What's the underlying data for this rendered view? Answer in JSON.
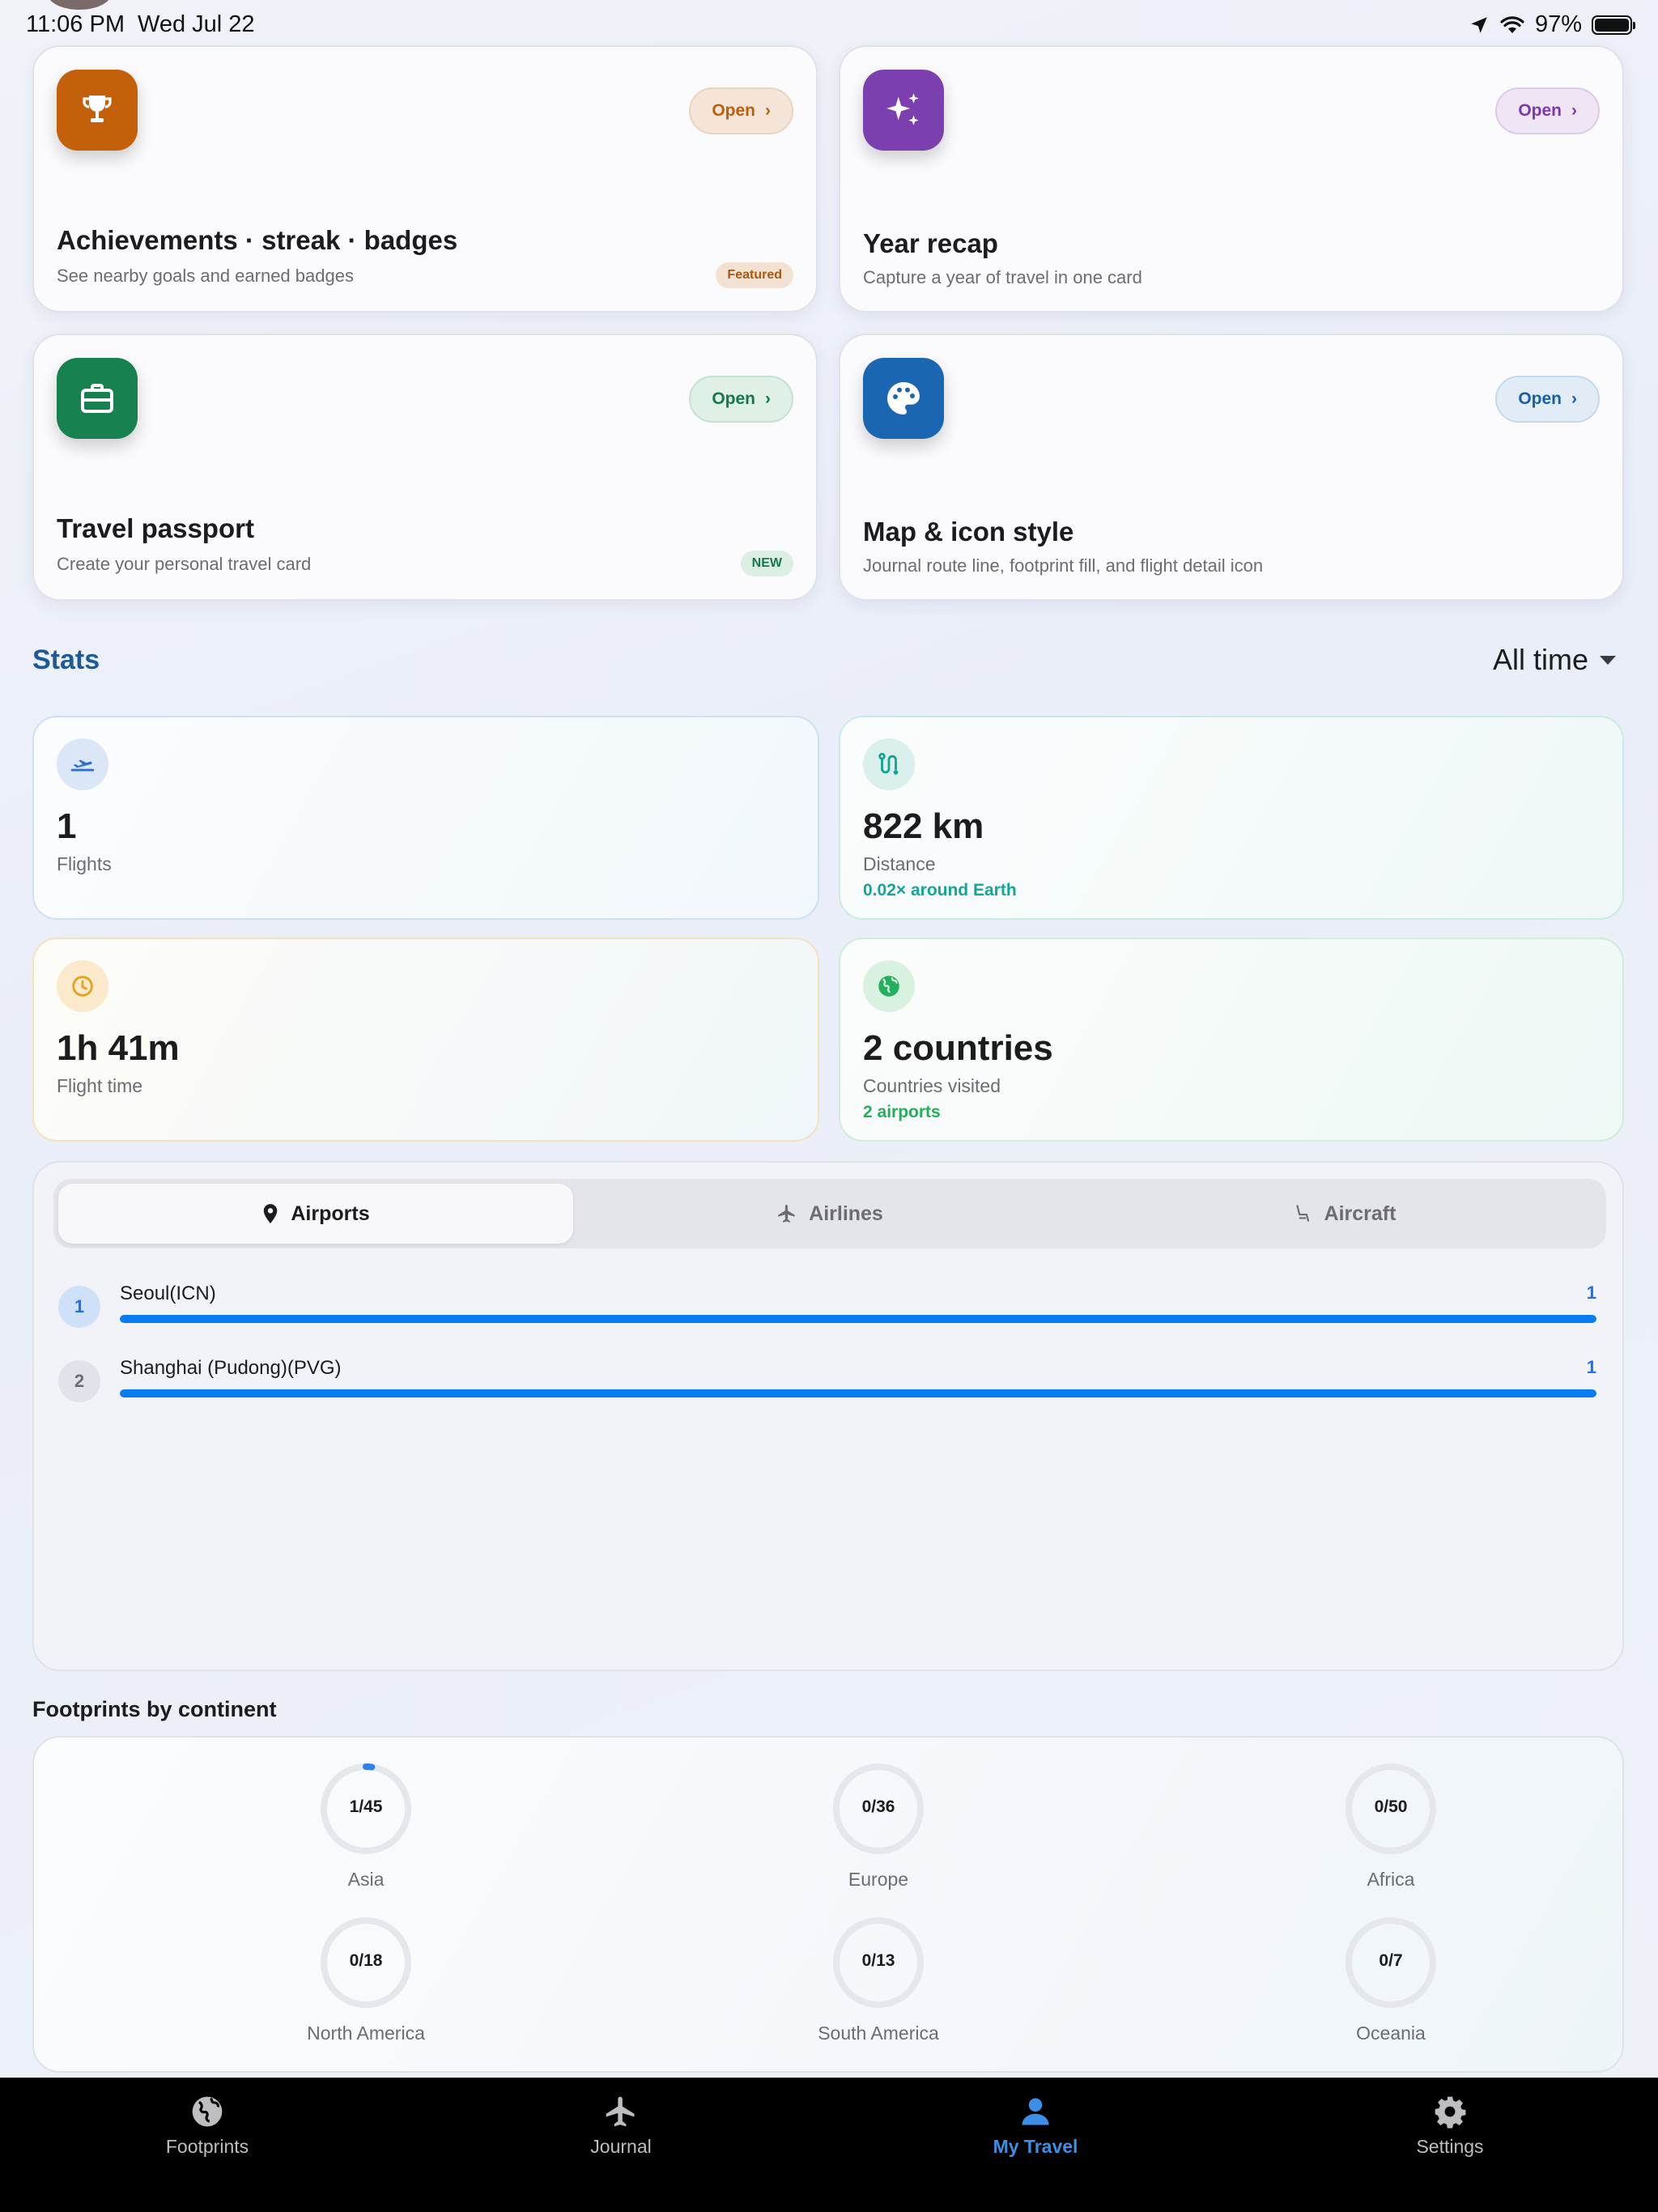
{
  "status_bar": {
    "time": "11:06 PM",
    "date": "Wed Jul 22",
    "battery": "97%"
  },
  "feature_cards": [
    {
      "title": "Achievements · streak · badges",
      "subtitle": "See nearby goals and earned badges",
      "open": "Open",
      "tag": "Featured",
      "icon": "trophy-icon",
      "color": "#c4600a"
    },
    {
      "title": "Year recap",
      "subtitle": "Capture a year of travel in one card",
      "open": "Open",
      "icon": "sparkles-icon",
      "color": "#7b3fb0"
    },
    {
      "title": "Travel passport",
      "subtitle": "Create your personal travel card",
      "open": "Open",
      "tag": "NEW",
      "icon": "briefcase-icon",
      "color": "#17814f"
    },
    {
      "title": "Map & icon style",
      "subtitle": "Journal route line, footprint fill, and flight detail icon",
      "open": "Open",
      "icon": "palette-icon",
      "color": "#1a66b0"
    }
  ],
  "stats": {
    "title": "Stats",
    "range": "All time",
    "tiles": [
      {
        "value": "1",
        "label": "Flights",
        "icon": "plane-departure-icon"
      },
      {
        "value": "822 km",
        "label": "Distance",
        "extra": "0.02× around Earth",
        "icon": "route-icon"
      },
      {
        "value": "1h 41m",
        "label": "Flight time",
        "icon": "clock-icon"
      },
      {
        "value": "2 countries",
        "label": "Countries visited",
        "extra": "2 airports",
        "icon": "globe-icon"
      }
    ]
  },
  "ranking": {
    "tabs": [
      "Airports",
      "Airlines",
      "Aircraft"
    ],
    "active_tab": "Airports",
    "rows": [
      {
        "rank": "1",
        "name": "Seoul(ICN)",
        "count": "1",
        "fill": 1.0
      },
      {
        "rank": "2",
        "name": "Shanghai (Pudong)(PVG)",
        "count": "1",
        "fill": 1.0
      }
    ]
  },
  "continents": {
    "title": "Footprints by continent",
    "items": [
      {
        "name": "Asia",
        "visited": 1,
        "total": 45,
        "label": "1/45"
      },
      {
        "name": "Europe",
        "visited": 0,
        "total": 36,
        "label": "0/36"
      },
      {
        "name": "Africa",
        "visited": 0,
        "total": 50,
        "label": "0/50"
      },
      {
        "name": "North America",
        "visited": 0,
        "total": 18,
        "label": "0/18"
      },
      {
        "name": "South America",
        "visited": 0,
        "total": 13,
        "label": "0/13"
      },
      {
        "name": "Oceania",
        "visited": 0,
        "total": 7,
        "label": "0/7"
      }
    ]
  },
  "tabbar": {
    "items": [
      {
        "label": "Footprints",
        "icon": "globe-icon"
      },
      {
        "label": "Journal",
        "icon": "airplane-icon"
      },
      {
        "label": "My Travel",
        "icon": "person-icon"
      },
      {
        "label": "Settings",
        "icon": "gear-icon"
      }
    ],
    "active": "My Travel"
  }
}
